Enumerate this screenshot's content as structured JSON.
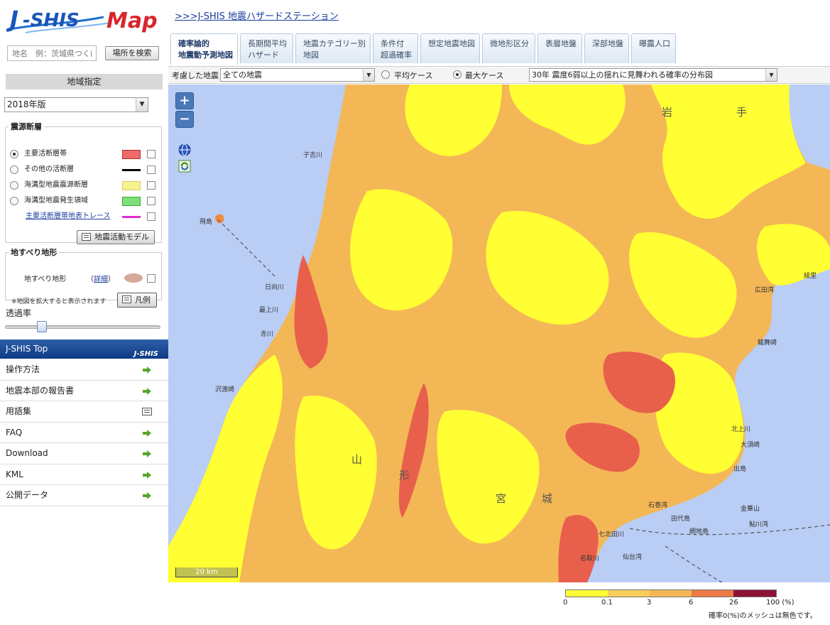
{
  "app": {
    "logo_text": "J-SHIS Map",
    "station_link": ">>>J-SHIS 地震ハザードステーション"
  },
  "search": {
    "placeholder": "地名　例：茨城県つくば市",
    "button": "場所を検索"
  },
  "region": {
    "heading": "地域指定",
    "version": "2018年版"
  },
  "fault_panel": {
    "legend": "震源断層",
    "layers": [
      {
        "label": "主要活断層帯",
        "selected": true,
        "color": "#f06a6a"
      },
      {
        "label": "その他の活断層",
        "selected": false,
        "color": "#000000"
      },
      {
        "label": "海溝型地震震源断層",
        "selected": false,
        "color": "#f6f28c"
      },
      {
        "label": "海溝型地震発生領域",
        "selected": false,
        "color": "#7ee07a"
      }
    ],
    "trace_link": "主要活断層帯地表トレース",
    "trace_color": "#e02ad2",
    "model_button": "地震活動モデル"
  },
  "landslide_panel": {
    "legend": "地すべり地形",
    "layer_label": "地すべり地形",
    "detail_open": "（",
    "detail_link": "詳細",
    "detail_close": "）",
    "note": "※地図を拡大すると表示されます",
    "legend_button": "凡例"
  },
  "transparency": {
    "label": "透過率",
    "value_fraction": 0.22
  },
  "top_section": {
    "title": "J-SHIS Top",
    "mini_logo": "J-SHIS"
  },
  "nav": [
    {
      "label": "操作方法",
      "icon": "arrow-icon"
    },
    {
      "label": "地震本部の報告書",
      "icon": "arrow-icon"
    },
    {
      "label": "用語集",
      "icon": "book-icon"
    },
    {
      "label": "FAQ",
      "icon": "arrow-icon"
    },
    {
      "label": "Download",
      "icon": "arrow-icon"
    },
    {
      "label": "KML",
      "icon": "arrow-icon"
    },
    {
      "label": "公開データ",
      "icon": "arrow-icon"
    }
  ],
  "tabs": [
    {
      "line1": "確率論的",
      "line2": "地震動予測地図",
      "active": true
    },
    {
      "line1": "長期間平均",
      "line2": "ハザード",
      "active": false
    },
    {
      "line1": "地震カテゴリー別",
      "line2": "地図",
      "active": false
    },
    {
      "line1": "条件付",
      "line2": "超過確率",
      "active": false
    },
    {
      "line1": "想定地震地図",
      "line2": "",
      "active": false
    },
    {
      "line1": "微地形区分",
      "line2": "",
      "active": false
    },
    {
      "line1": "表層地盤",
      "line2": "",
      "active": false
    },
    {
      "line1": "深部地盤",
      "line2": "",
      "active": false
    },
    {
      "line1": "曝露人口",
      "line2": "",
      "active": false
    }
  ],
  "controls": {
    "considered_label": "考慮した地震",
    "considered_value": "全ての地震",
    "avg_case": "平均ケース",
    "max_case": "最大ケース",
    "max_selected": true,
    "map_type": "30年 震度6弱以上の揺れに見舞われる確率の分布図"
  },
  "map": {
    "zoom_in": "+",
    "zoom_out": "−",
    "scale": "20 km",
    "place_labels": [
      "岩",
      "手",
      "子吉川",
      "飛島",
      "日向川",
      "最上川",
      "赤川",
      "広田湾",
      "龍舞崎",
      "北上川",
      "大須崎",
      "出島",
      "金華山",
      "鮎川湾",
      "網地島",
      "田代島",
      "石巻湾",
      "七北田川",
      "名取川",
      "仙台湾",
      "綾里",
      "山",
      "形",
      "宮",
      "城",
      "沢渡崎"
    ],
    "colors": {
      "sea": "#b9cdf5",
      "very_low": "#ffff33",
      "low": "#ffef2e",
      "mid": "#f4b756",
      "high": "#f08a3e",
      "very_high": "#e8604c",
      "extreme": "#8e1035"
    }
  },
  "color_legend": {
    "ticks": [
      "0",
      "0.1",
      "3",
      "6",
      "26",
      "100 (%)"
    ],
    "note": "確率0(%)のメッシュは無色です。"
  }
}
